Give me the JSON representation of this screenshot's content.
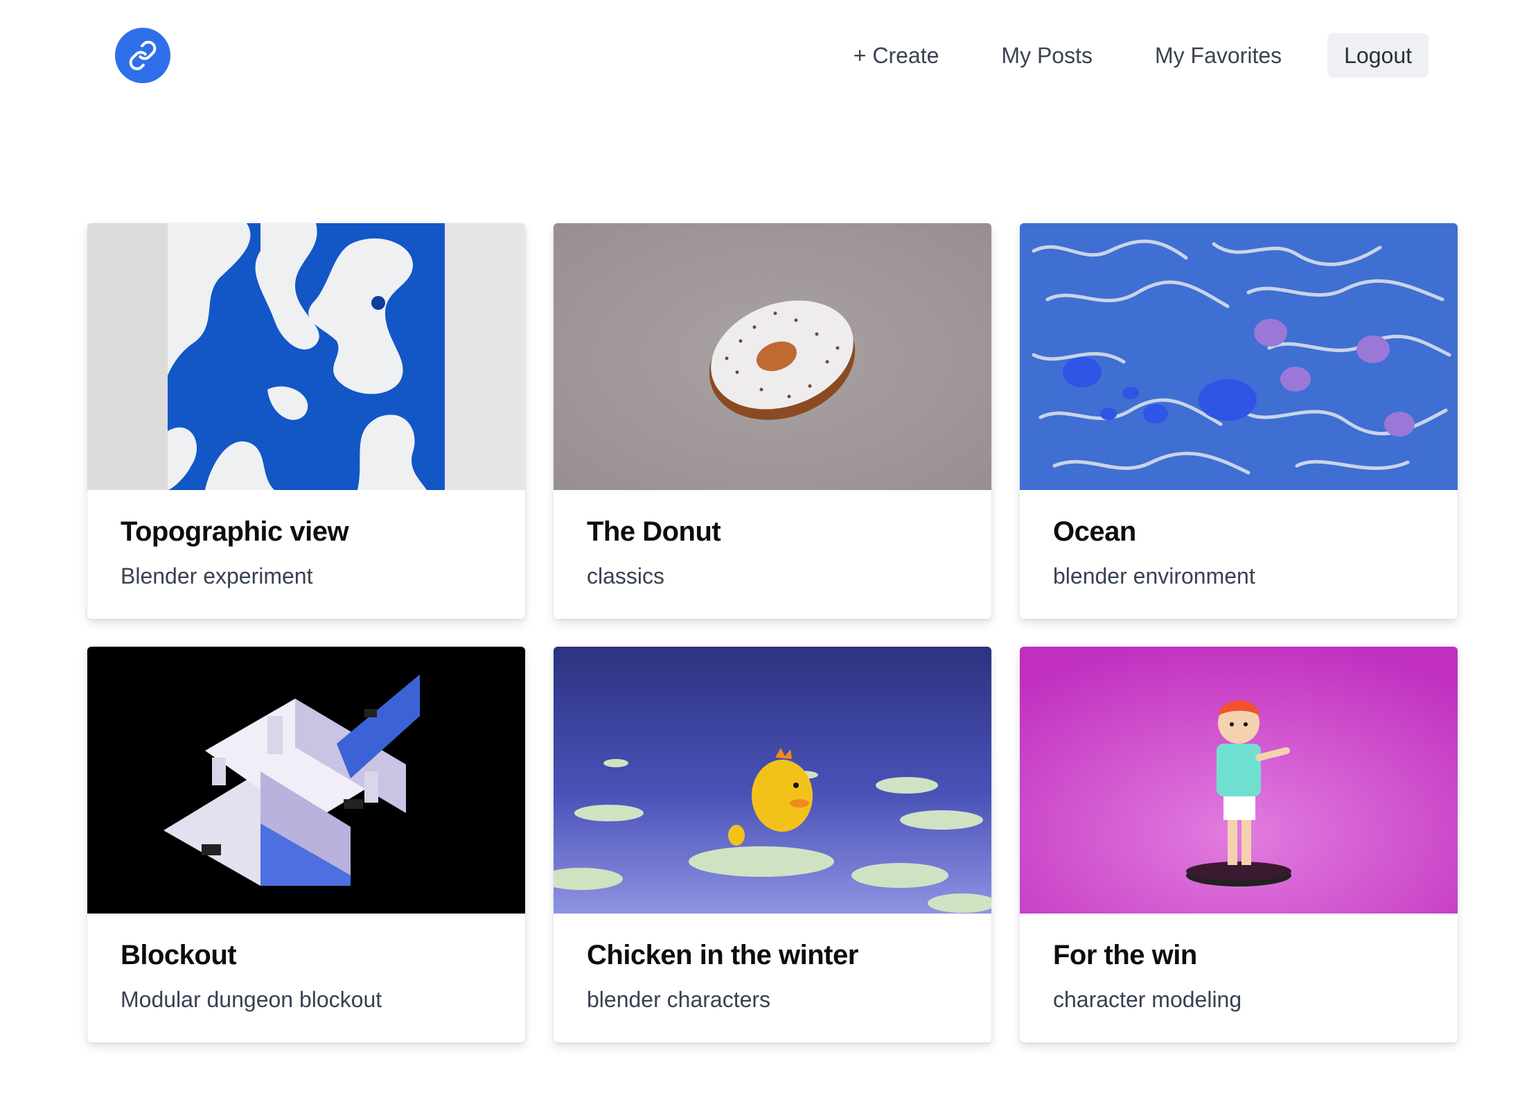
{
  "header": {
    "logo_icon": "link-icon",
    "logo_color": "#2f6fea",
    "nav": {
      "create_label": "+ Create",
      "my_posts_label": "My Posts",
      "my_favorites_label": "My Favorites",
      "logout_label": "Logout"
    }
  },
  "posts": [
    {
      "title": "Topographic view",
      "subtitle": "Blender experiment"
    },
    {
      "title": "The Donut",
      "subtitle": "classics"
    },
    {
      "title": "Ocean",
      "subtitle": "blender environment"
    },
    {
      "title": "Blockout",
      "subtitle": "Modular dungeon blockout"
    },
    {
      "title": "Chicken in the winter",
      "subtitle": "blender characters"
    },
    {
      "title": "For the win",
      "subtitle": "character modeling"
    }
  ]
}
